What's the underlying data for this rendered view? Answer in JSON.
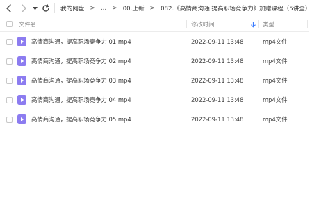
{
  "toolbar": {
    "back_icon": "chevron-left-icon",
    "forward_icon": "chevron-right-icon",
    "history_icon": "triangle-down-icon",
    "refresh_icon": "refresh-icon"
  },
  "breadcrumb": {
    "items": [
      "我的网盘",
      "...",
      "00.上新",
      "082.《高情商沟通 提高职场竞争力》加赠课程（5讲全）"
    ],
    "separator": ">"
  },
  "columns": {
    "name": "文件名",
    "modified": "修改时间",
    "modified_sort_icon": "arrow-down-icon",
    "type": "类型"
  },
  "files": [
    {
      "name": "高情商沟通，提高职场竞争力 01.mp4",
      "modified": "2022-09-11 13:48",
      "type": "mp4文件",
      "icon": "video-file-icon"
    },
    {
      "name": "高情商沟通，提高职场竞争力 02.mp4",
      "modified": "2022-09-11 13:48",
      "type": "mp4文件",
      "icon": "video-file-icon"
    },
    {
      "name": "高情商沟通，提高职场竞争力 03.mp4",
      "modified": "2022-09-11 13:48",
      "type": "mp4文件",
      "icon": "video-file-icon"
    },
    {
      "name": "高情商沟通，提高职场竞争力 04.mp4",
      "modified": "2022-09-11 13:48",
      "type": "mp4文件",
      "icon": "video-file-icon"
    },
    {
      "name": "高情商沟通，提高职场竞争力 05.mp4",
      "modified": "2022-09-11 13:48",
      "type": "mp4文件",
      "icon": "video-file-icon"
    }
  ],
  "colors": {
    "accent": "#3b7cff",
    "file_icon": "#8c7cf0"
  }
}
